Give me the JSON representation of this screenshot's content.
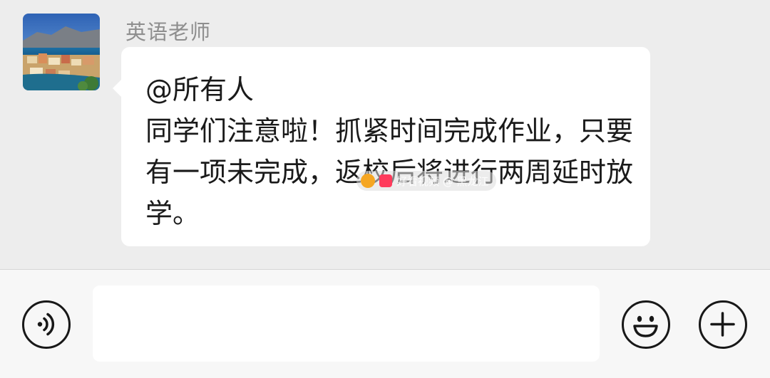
{
  "chat": {
    "sender_name": "英语老师",
    "message_text": "@所有人\n同学们注意啦！抓紧时间完成作业，只要有一项未完成，返校后将进行两周延时放学。",
    "watermark_text": "好看视频 @ 黑龙江"
  },
  "input_bar": {
    "input_value": "",
    "icons": {
      "voice": "voice-icon",
      "emoji": "smiley-icon",
      "more": "plus-icon"
    }
  },
  "colors": {
    "background": "#ededed",
    "bubble": "#ffffff",
    "name_text": "#8e8e8e",
    "message_text": "#1a1a1a",
    "input_bar": "#f7f7f7",
    "icon_stroke": "#181818"
  }
}
